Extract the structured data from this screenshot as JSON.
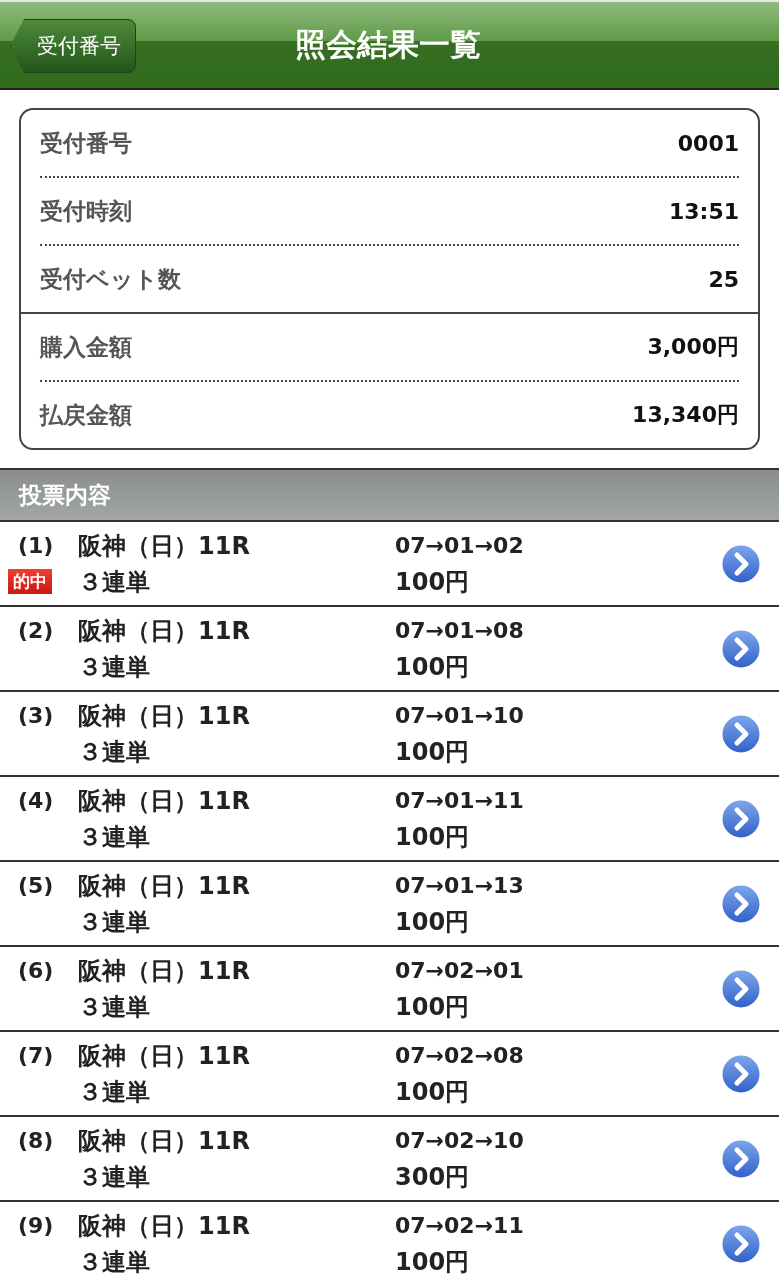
{
  "header": {
    "back_label": "受付番号",
    "title": "照会結果一覧"
  },
  "summary": {
    "groups": [
      [
        {
          "label": "受付番号",
          "value": "0001"
        },
        {
          "label": "受付時刻",
          "value": "13:51"
        },
        {
          "label": "受付ベット数",
          "value": "25"
        }
      ],
      [
        {
          "label": "購入金額",
          "value": "3,000円"
        },
        {
          "label": "払戻金額",
          "value": "13,340円"
        }
      ]
    ]
  },
  "section": {
    "title": "投票内容"
  },
  "bets": [
    {
      "number": "(1)",
      "race": "阪神（日）11R",
      "type": "３連単",
      "combo": "07→01→02",
      "amount": "100円",
      "badge": "的中"
    },
    {
      "number": "(2)",
      "race": "阪神（日）11R",
      "type": "３連単",
      "combo": "07→01→08",
      "amount": "100円"
    },
    {
      "number": "(3)",
      "race": "阪神（日）11R",
      "type": "３連単",
      "combo": "07→01→10",
      "amount": "100円"
    },
    {
      "number": "(4)",
      "race": "阪神（日）11R",
      "type": "３連単",
      "combo": "07→01→11",
      "amount": "100円"
    },
    {
      "number": "(5)",
      "race": "阪神（日）11R",
      "type": "３連単",
      "combo": "07→01→13",
      "amount": "100円"
    },
    {
      "number": "(6)",
      "race": "阪神（日）11R",
      "type": "３連単",
      "combo": "07→02→01",
      "amount": "100円"
    },
    {
      "number": "(7)",
      "race": "阪神（日）11R",
      "type": "３連単",
      "combo": "07→02→08",
      "amount": "100円"
    },
    {
      "number": "(8)",
      "race": "阪神（日）11R",
      "type": "３連単",
      "combo": "07→02→10",
      "amount": "300円"
    },
    {
      "number": "(9)",
      "race": "阪神（日）11R",
      "type": "３連単",
      "combo": "07→02→11",
      "amount": "100円"
    }
  ]
}
